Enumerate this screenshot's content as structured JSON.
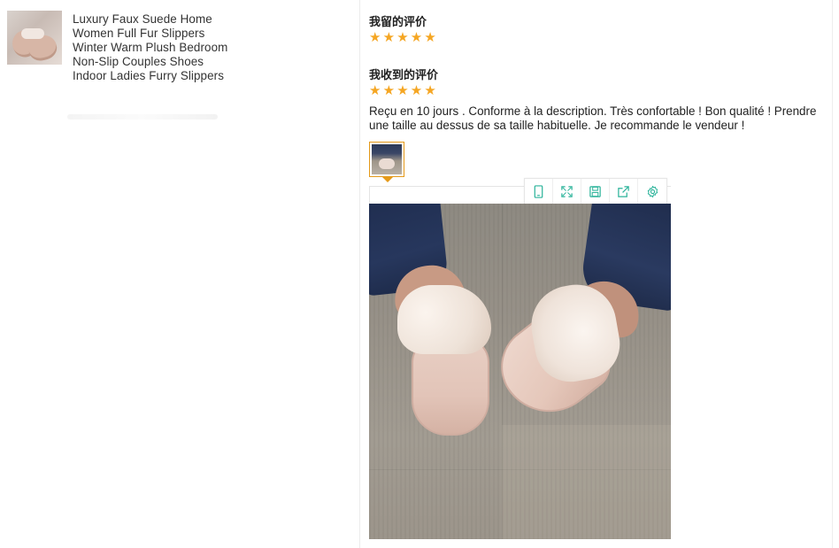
{
  "product": {
    "title": "Luxury Faux Suede Home Women Full Fur Slippers Winter Warm Plush Bedroom Non-Slip Couples Shoes Indoor Ladies Furry Slippers"
  },
  "my_review": {
    "heading": "我留的评价",
    "rating": 5
  },
  "received_review": {
    "heading": "我收到的评价",
    "rating": 5,
    "comment": "Reçu en 10 jours . Conforme à la description. Très confortable ! Bon qualité ! Prendre une taille au dessus de sa taille habituelle. Je recommande le vendeur !"
  },
  "viewer_toolbar": {
    "tools": [
      "phone-icon",
      "fullscreen-icon",
      "save-icon",
      "share-icon",
      "settings-icon"
    ],
    "icon_color": "#2bb39a"
  },
  "colors": {
    "star": "#f5a623",
    "thumb_border": "#e59a1a"
  }
}
